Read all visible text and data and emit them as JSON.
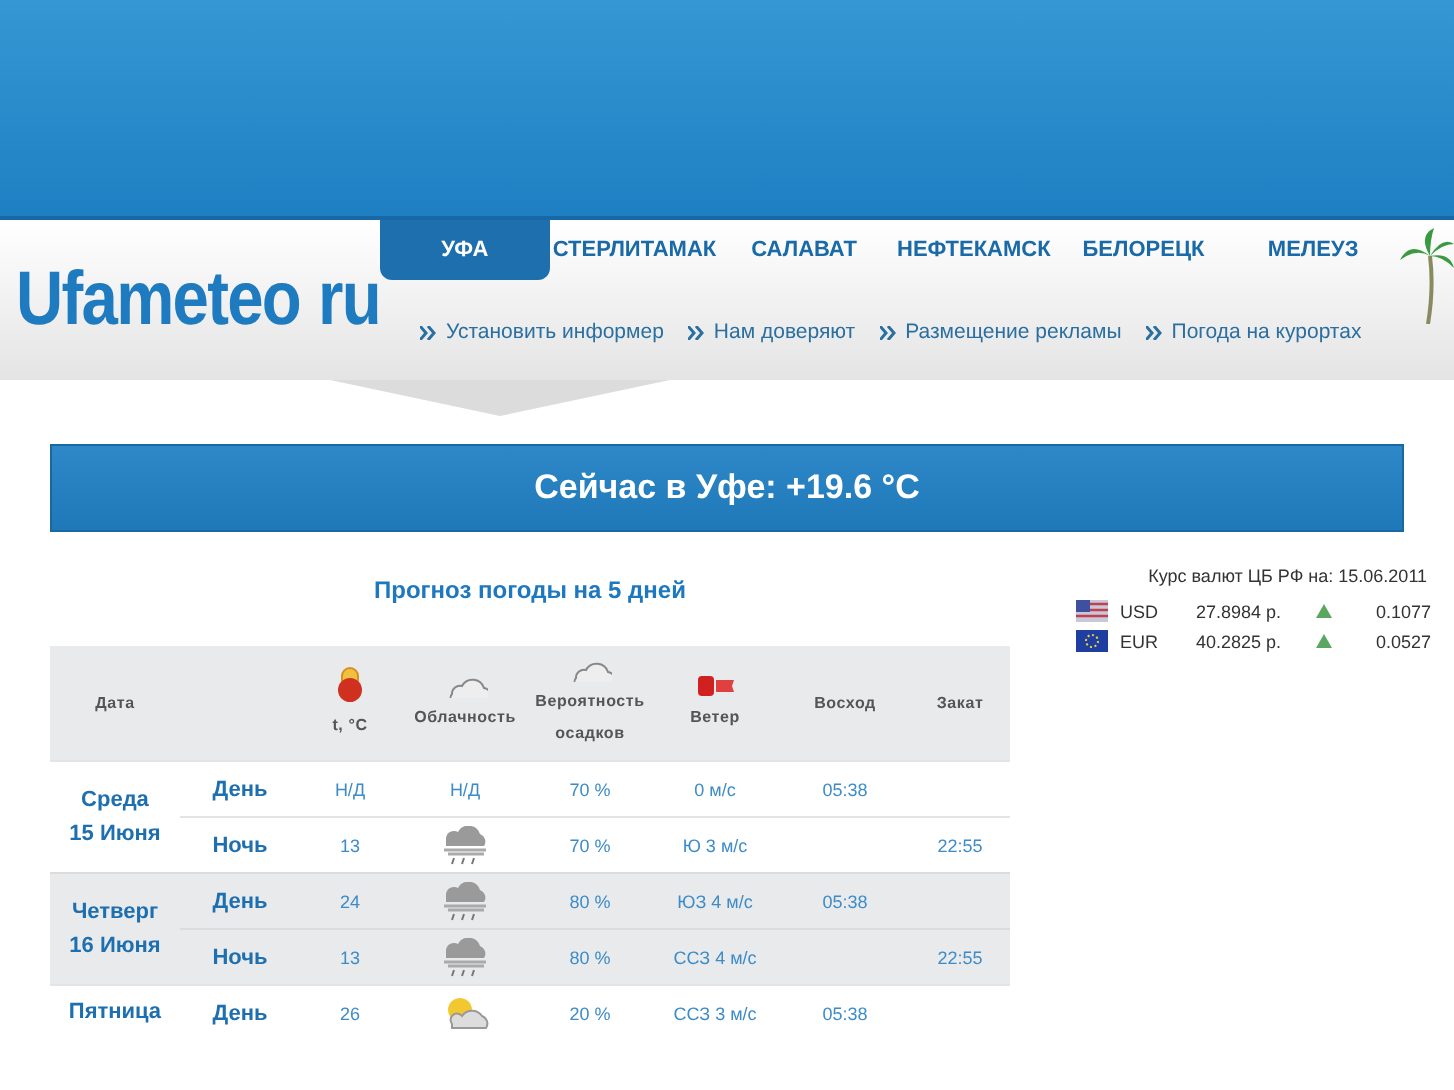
{
  "cities": [
    {
      "label": "УФА",
      "selected": true
    },
    {
      "label": "СТЕРЛИТАМАК",
      "selected": false
    },
    {
      "label": "САЛАВАТ",
      "selected": false
    },
    {
      "label": "НЕФТЕКАМСК",
      "selected": false
    },
    {
      "label": "БЕЛОРЕЦК",
      "selected": false
    },
    {
      "label": "МЕЛЕУЗ",
      "selected": false
    }
  ],
  "logo": {
    "name": "Ufameteo",
    "suffix": "ru"
  },
  "links": [
    "Установить информер",
    "Нам доверяют",
    "Размещение рекламы",
    "Погода на курортах"
  ],
  "current": "Сейчас в Уфе: +19.6 °C",
  "forecast": {
    "title": "Прогноз погоды на 5 дней",
    "columns": [
      "Дата",
      "t, °C",
      "Облачность",
      "Вероятность осадков",
      "Ветер",
      "Восход",
      "Закат"
    ],
    "days": [
      {
        "weekday": "Среда",
        "date": "15 Июня",
        "periods": [
          {
            "name": "День",
            "temp": "Н/Д",
            "kind": "text",
            "clouds": "Н/Д",
            "precip": "70 %",
            "wind": "0 м/с",
            "sunrise": "05:38"
          },
          {
            "name": "Ночь",
            "temp": "13",
            "kind": "rain",
            "precip": "70 %",
            "wind": "Ю 3 м/с",
            "sunset": "22:55"
          }
        ]
      },
      {
        "weekday": "Четверг",
        "date": "16 Июня",
        "periods": [
          {
            "name": "День",
            "temp": "24",
            "kind": "rain",
            "precip": "80 %",
            "wind": "ЮЗ 4 м/с",
            "sunrise": "05:38"
          },
          {
            "name": "Ночь",
            "temp": "13",
            "kind": "rain",
            "precip": "80 %",
            "wind": "ССЗ 4 м/с",
            "sunset": "22:55"
          }
        ]
      },
      {
        "weekday": "Пятница",
        "periods": [
          {
            "name": "День",
            "temp": "26",
            "kind": "partly_sunny",
            "precip": "20 %",
            "wind": "ССЗ 3 м/с",
            "sunrise": "05:38"
          }
        ]
      }
    ]
  },
  "currency": {
    "title": "Курс валют ЦБ РФ на: 15.06.2011",
    "rates": [
      {
        "code": "USD",
        "kind": "us",
        "rate": "27.8984 р.",
        "rising": true,
        "change": "0.1077"
      },
      {
        "code": "EUR",
        "kind": "eu",
        "rate": "40.2825 р.",
        "rising": true,
        "change": "0.0527"
      }
    ]
  }
}
